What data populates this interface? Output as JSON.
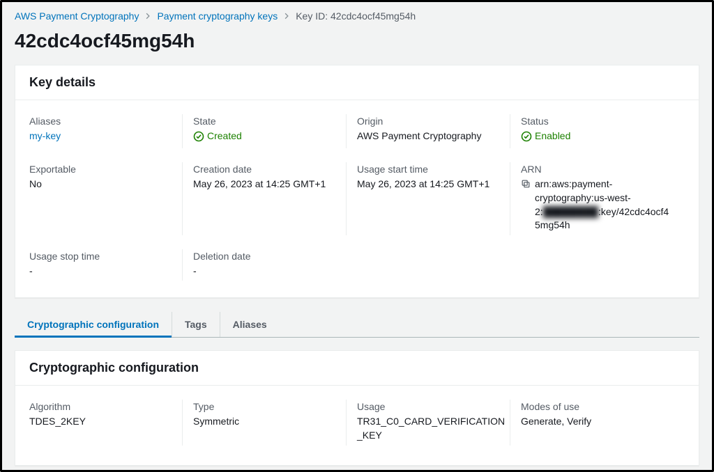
{
  "breadcrumb": {
    "root": "AWS Payment Cryptography",
    "level1": "Payment cryptography keys",
    "current": "Key ID: 42cdc4ocf45mg54h"
  },
  "page_title": "42cdc4ocf45mg54h",
  "key_details": {
    "heading": "Key details",
    "aliases_label": "Aliases",
    "aliases_value": "my-key",
    "state_label": "State",
    "state_value": "Created",
    "origin_label": "Origin",
    "origin_value": "AWS Payment Cryptography",
    "status_label": "Status",
    "status_value": "Enabled",
    "exportable_label": "Exportable",
    "exportable_value": "No",
    "creation_date_label": "Creation date",
    "creation_date_value": "May 26, 2023 at 14:25 GMT+1",
    "usage_start_label": "Usage start time",
    "usage_start_value": "May 26, 2023 at 14:25 GMT+1",
    "arn_label": "ARN",
    "arn_prefix": "arn:aws:payment-cryptography:us-west-2:",
    "arn_account_masked": "████████",
    "arn_suffix": ":key/42cdc4ocf45mg54h",
    "usage_stop_label": "Usage stop time",
    "usage_stop_value": "-",
    "deletion_date_label": "Deletion date",
    "deletion_date_value": "-"
  },
  "tabs": {
    "crypto": "Cryptographic configuration",
    "tags": "Tags",
    "aliases": "Aliases"
  },
  "crypto_config": {
    "heading": "Cryptographic configuration",
    "algorithm_label": "Algorithm",
    "algorithm_value": "TDES_2KEY",
    "type_label": "Type",
    "type_value": "Symmetric",
    "usage_label": "Usage",
    "usage_value": "TR31_C0_CARD_VERIFICATION_KEY",
    "modes_label": "Modes of use",
    "modes_value": "Generate, Verify"
  }
}
